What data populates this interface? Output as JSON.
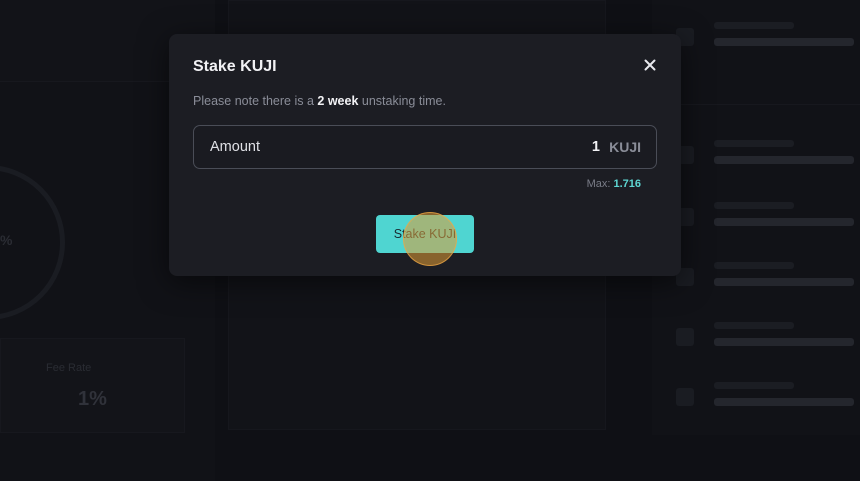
{
  "modal": {
    "title": "Stake KUJI",
    "note": {
      "prefix": "Please note there is a ",
      "emphasis": "2 week",
      "suffix": " unstaking time."
    },
    "amount": {
      "label": "Amount",
      "value": "1",
      "unit": "KUJI"
    },
    "max": {
      "label": "Max:",
      "value": "1.716"
    },
    "stake_button": "Stake KUJI"
  },
  "background": {
    "left_ring_label": "%",
    "left_card_title": "Fee Rate",
    "left_card_value": "1%"
  },
  "colors": {
    "accent": "#4fd5d1",
    "modal_bg": "#1c1d23",
    "page_bg": "#0f1015"
  },
  "icons": {
    "close": "close-icon"
  }
}
